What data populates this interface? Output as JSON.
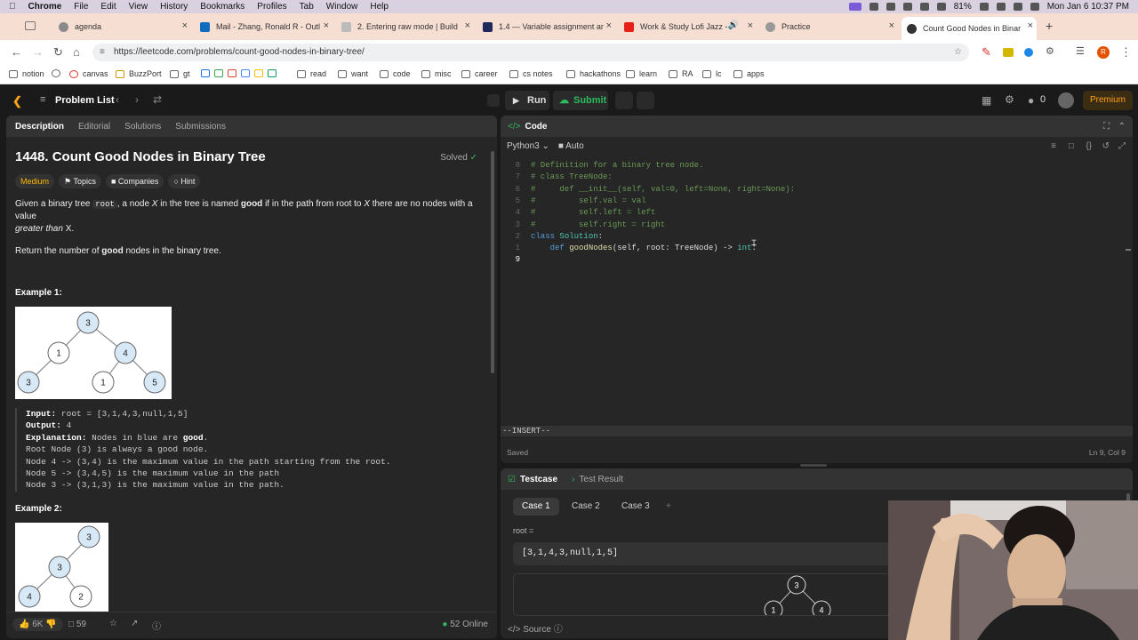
{
  "menubar": {
    "app": "Chrome",
    "items": [
      "File",
      "Edit",
      "View",
      "History",
      "Bookmarks",
      "Profiles",
      "Tab",
      "Window",
      "Help"
    ],
    "battery": "81%",
    "clock": "Mon Jan 6  10:37 PM"
  },
  "tabs": [
    {
      "label": "agenda",
      "color": "#8a8a8a"
    },
    {
      "label": "Mail - Zhang, Ronald R - Outl",
      "color": "#0f6cbd"
    },
    {
      "label": "2. Entering raw mode | Build",
      "color": "#bbbbbb"
    },
    {
      "label": "1.4 — Variable assignment ar",
      "color": "#1e2a5a"
    },
    {
      "label": "Work & Study Lofi Jazz -",
      "color": "#e62117"
    },
    {
      "label": "Practice",
      "color": "#999999"
    },
    {
      "label": "Count Good Nodes in Binary",
      "color": "#333333"
    }
  ],
  "address": {
    "url": "https://leetcode.com/problems/count-good-nodes-in-binary-tree/"
  },
  "bookmarks": [
    "notion",
    "canvas",
    "BuzzPort",
    "gt",
    "read",
    "want",
    "code",
    "misc",
    "career",
    "cs notes",
    "hackathons",
    "learn",
    "RA",
    "lc",
    "apps"
  ],
  "lc": {
    "problem_list": "Problem List",
    "run": "Run",
    "submit": "Submit",
    "streak": "0",
    "premium": "Premium"
  },
  "left": {
    "tabs": [
      "Description",
      "Editorial",
      "Solutions",
      "Submissions"
    ],
    "title": "1448. Count Good Nodes in Binary Tree",
    "solved": "Solved",
    "tags": [
      "Medium",
      "Topics",
      "Companies",
      "Hint"
    ],
    "desc1_a": "Given a binary tree ",
    "desc1_code": "root",
    "desc1_b": ", a node ",
    "desc1_x": "X",
    "desc1_c": " in the tree is named ",
    "desc1_good": "good",
    "desc1_d": " if in the path from root to ",
    "desc1_x2": "X",
    "desc1_e": " there are no nodes with a value ",
    "desc1_f": "greater than",
    "desc1_g": " X.",
    "desc2_a": "Return the number of ",
    "desc2_good": "good",
    "desc2_b": " nodes in the binary tree.",
    "example1": "Example 1:",
    "example2": "Example 2:",
    "ex1_input_label": "Input:",
    "ex1_input": " root = [3,1,4,3,null,1,5]",
    "ex1_output_label": "Output:",
    "ex1_output": " 4",
    "ex1_expl_label": "Explanation:",
    "ex1_expl_a": " Nodes in blue are ",
    "ex1_expl_good": "good",
    "ex1_expl_b": ".",
    "ex1_lines": [
      "Root Node (3) is always a good node.",
      "Node 4 -> (3,4) is the maximum value in the path starting from the root.",
      "Node 5 -> (3,4,5) is the maximum value in the path",
      "Node 3 -> (3,1,3) is the maximum value in the path."
    ],
    "tree1": [
      "3",
      "1",
      "4",
      "3",
      "1",
      "5"
    ],
    "tree2": [
      "3",
      "3",
      "4",
      "2"
    ],
    "likes": "6K",
    "comments": "59",
    "online": "52 Online"
  },
  "code": {
    "header": "Code",
    "lang": "Python3",
    "mode": "Auto",
    "lines": [
      {
        "n": "8",
        "html": "<span class='cmt'># Definition for a binary tree node.</span>"
      },
      {
        "n": "7",
        "html": "<span class='cmt'># class TreeNode:</span>"
      },
      {
        "n": "6",
        "html": "<span class='cmt'>#     def __init__(self, val=0, left=None, right=None):</span>"
      },
      {
        "n": "5",
        "html": "<span class='cmt'>#         self.val = val</span>"
      },
      {
        "n": "4",
        "html": "<span class='cmt'>#         self.left = left</span>"
      },
      {
        "n": "3",
        "html": "<span class='cmt'>#         self.right = right</span>"
      },
      {
        "n": "2",
        "html": "<span class='kw'>class</span> <span class='cls'>Solution</span><span class='tx'>:</span>"
      },
      {
        "n": "1",
        "html": "<span class='tx'>    </span><span class='kw'>def</span> <span class='fn'>goodNodes</span><span class='tx'>(self, root: TreeNode) -&gt; </span><span class='cls'>int</span><span class='tx'>:</span>"
      },
      {
        "n": "9",
        "html": "",
        "cur": true
      }
    ],
    "insert": "--INSERT--",
    "saved": "Saved",
    "pos": "Ln 9, Col 9"
  },
  "test": {
    "tabs": [
      "Testcase",
      "Test Result"
    ],
    "cases": [
      "Case 1",
      "Case 2",
      "Case 3"
    ],
    "add": "+",
    "root_label": "root =",
    "root_value": "[3,1,4,3,null,1,5]",
    "viz_nodes": [
      "3",
      "1",
      "4"
    ],
    "source": "Source"
  }
}
